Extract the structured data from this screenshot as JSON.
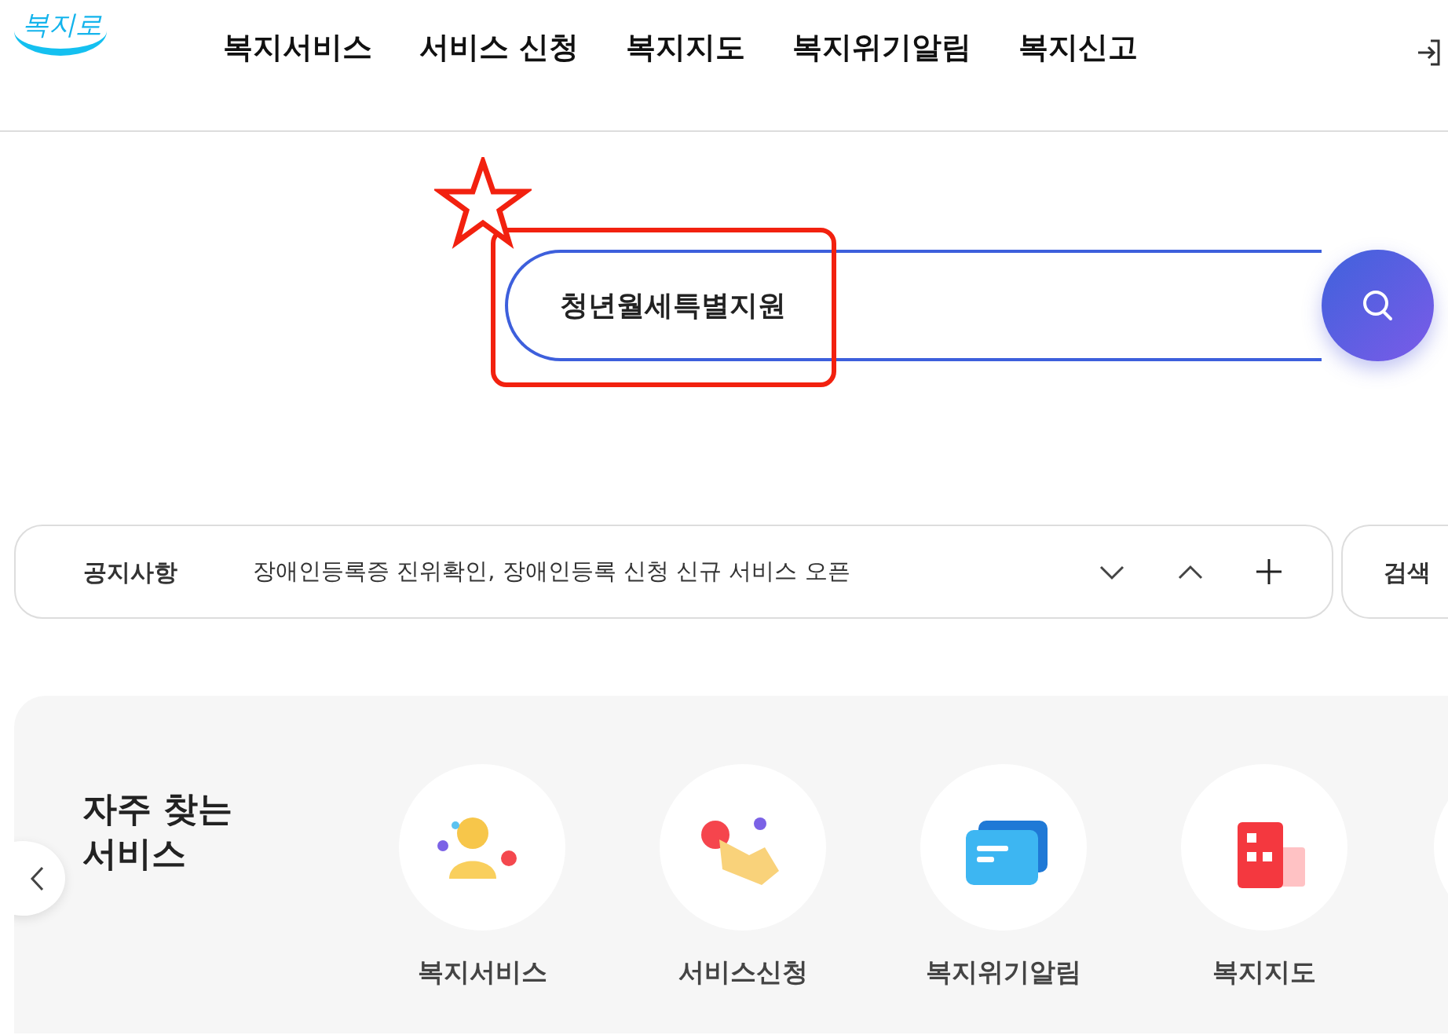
{
  "header": {
    "logo": "복지로",
    "nav": [
      {
        "label": "복지서비스"
      },
      {
        "label": "서비스 신청"
      },
      {
        "label": "복지지도"
      },
      {
        "label": "복지위기알림"
      },
      {
        "label": "복지신고"
      }
    ]
  },
  "search": {
    "value": "청년월세특별지원",
    "highlighted": true
  },
  "notice": {
    "label": "공지사항",
    "text": "장애인등록증 진위확인, 장애인등록 신청 신규 서비스 오픈"
  },
  "side_box": {
    "label": "검색"
  },
  "frequent": {
    "title": "자주 찾는\n서비스",
    "items": [
      {
        "label": "복지서비스",
        "kind": "person"
      },
      {
        "label": "서비스신청",
        "kind": "hand"
      },
      {
        "label": "복지위기알림",
        "kind": "message"
      },
      {
        "label": "복지지도",
        "kind": "building"
      }
    ]
  }
}
